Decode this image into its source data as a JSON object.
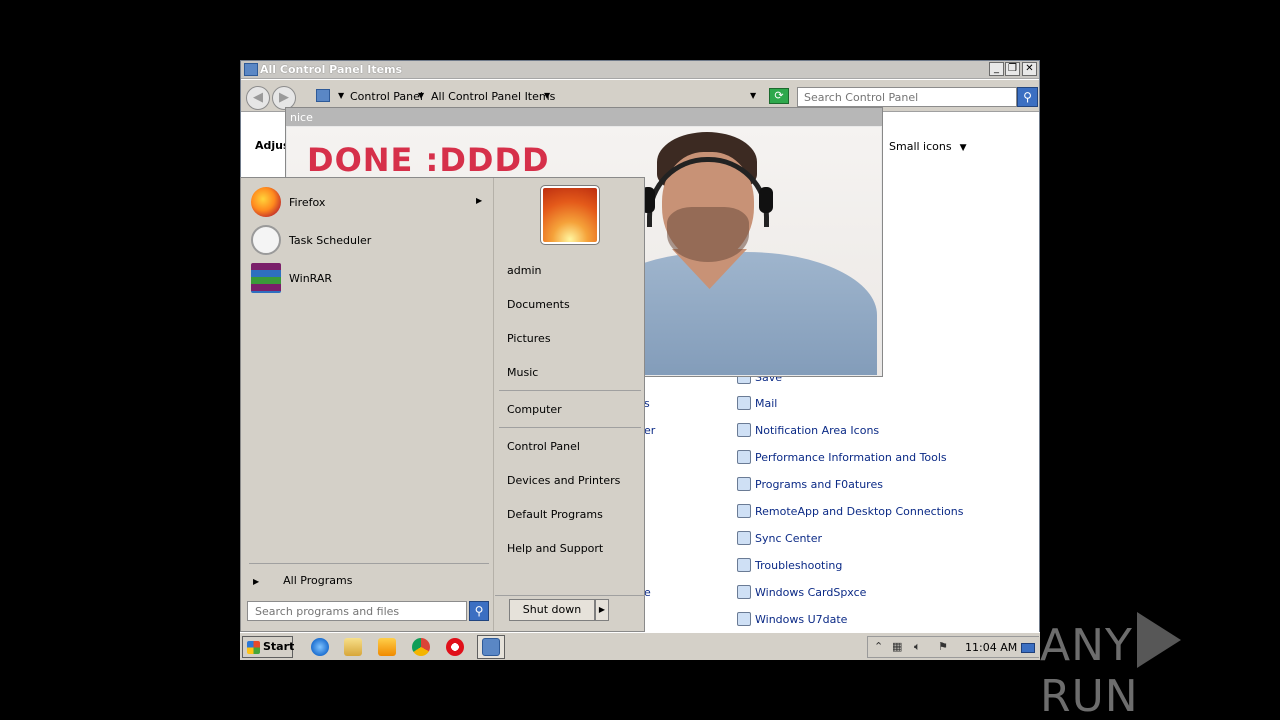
{
  "control_panel": {
    "window_title": "All Control Panel Items",
    "breadcrumb": [
      "Control Panel",
      "All Control Panel Items"
    ],
    "search_placeholder": "Search Control Panel",
    "heading_partial": "Adjus",
    "view_by_value": "Small icons",
    "visible_fragments": [
      "s",
      "er",
      "e"
    ],
    "items": [
      {
        "label": "Sa​v​e"
      },
      {
        "label": "Mail"
      },
      {
        "label": "Notification Area Icons"
      },
      {
        "label": "Performance Information and Tools"
      },
      {
        "label": "Programs and F0atures"
      },
      {
        "label": "RemoteApp and Desktop Connections"
      },
      {
        "label": "Sync Center"
      },
      {
        "label": "Troubleshooting"
      },
      {
        "label": "Windows CardSpxce"
      },
      {
        "label": "Windows U7date"
      }
    ]
  },
  "popup": {
    "title": "nice",
    "banner_text": "DONE :DDDD"
  },
  "start_menu": {
    "programs": [
      {
        "label": "Firefox",
        "icon": "firefox-icon",
        "has_submenu": true
      },
      {
        "label": "Task Scheduler",
        "icon": "clock-icon",
        "has_submenu": false
      },
      {
        "label": "WinRAR",
        "icon": "winrar-icon",
        "has_submenu": false
      }
    ],
    "all_programs_label": "All Programs",
    "search_placeholder": "Search programs and files",
    "right_links": {
      "user": "admin",
      "documents": "Documents",
      "pictures": "Pictures",
      "music": "Music",
      "computer": "Computer",
      "control_panel": "Control Panel",
      "devices": "Devices and Printers",
      "default_programs": "Default Programs",
      "help": "Help and Support"
    },
    "shutdown_label": "Shut down"
  },
  "taskbar": {
    "start_label": "Start",
    "clock": "11:04 AM",
    "pinned_icons": [
      "ie-icon",
      "explorer-icon",
      "media-player-icon",
      "chrome-icon",
      "opera-icon",
      "control-panel-icon"
    ]
  },
  "watermark": {
    "left": "ANY",
    "right": "RUN"
  }
}
